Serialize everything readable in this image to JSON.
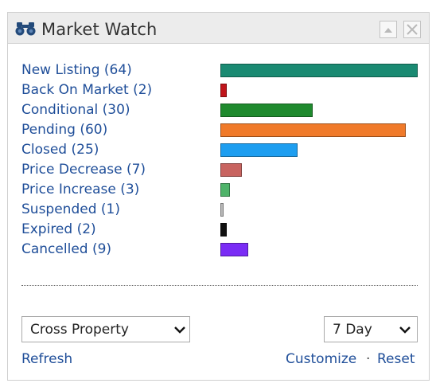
{
  "header": {
    "title": "Market Watch",
    "icon": "binoculars-icon",
    "buttons": [
      "collapse-up-icon",
      "close-icon"
    ]
  },
  "listings": [
    {
      "label": "New Listing (64)",
      "count": 64,
      "color": "#1a8a72"
    },
    {
      "label": "Back On Market (2)",
      "count": 2,
      "color": "#c0151b"
    },
    {
      "label": "Conditional (30)",
      "count": 30,
      "color": "#1f8a2e"
    },
    {
      "label": "Pending (60)",
      "count": 60,
      "color": "#f07a2a"
    },
    {
      "label": "Closed (25)",
      "count": 25,
      "color": "#1e9ef0"
    },
    {
      "label": "Price Decrease (7)",
      "count": 7,
      "color": "#c86460"
    },
    {
      "label": "Price Increase (3)",
      "count": 3,
      "color": "#4fb46a"
    },
    {
      "label": "Suspended (1)",
      "count": 1,
      "color": "#bbbbbb"
    },
    {
      "label": "Expired (2)",
      "count": 2,
      "color": "#111111"
    },
    {
      "label": "Cancelled (9)",
      "count": 9,
      "color": "#7a2cf5"
    }
  ],
  "filters": {
    "property_type": "Cross Property",
    "period": "7 Day"
  },
  "footer": {
    "refresh": "Refresh",
    "customize": "Customize",
    "separator": "·",
    "reset": "Reset"
  }
}
